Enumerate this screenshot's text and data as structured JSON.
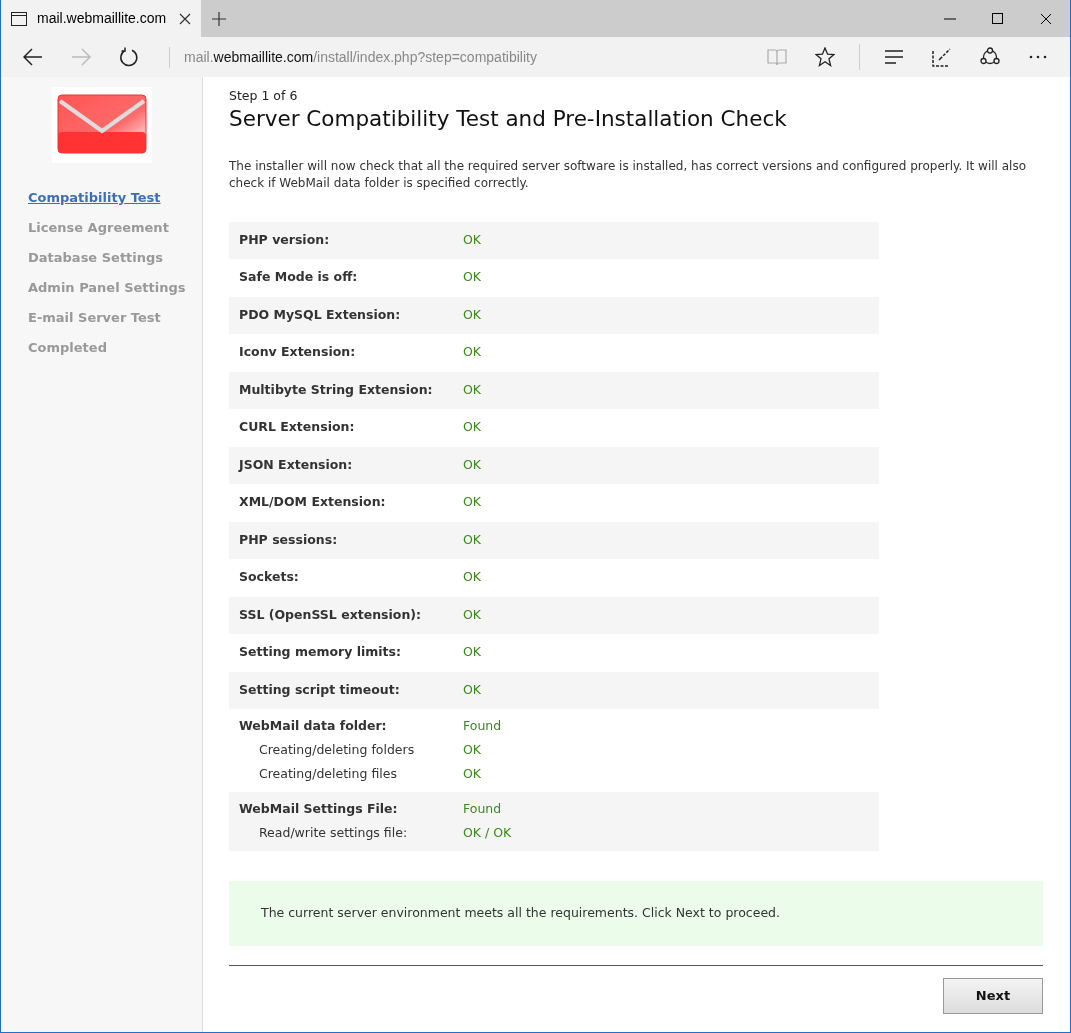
{
  "browser": {
    "tab_title": "mail.webmaillite.com",
    "url": "mail.**webmaillite.com**/install/index.php?step=compatibility",
    "forward_disabled": true,
    "reading_view_disabled": true
  },
  "sidebar": {
    "steps": [
      {
        "label": "Compatibility Test",
        "selected": true
      },
      {
        "label": "License Agreement",
        "selected": false
      },
      {
        "label": "Database Settings",
        "selected": false
      },
      {
        "label": "Admin Panel Settings",
        "selected": false
      },
      {
        "label": "E-mail Server Test",
        "selected": false
      },
      {
        "label": "Completed",
        "selected": false
      }
    ]
  },
  "step_indicator": "Step 1 of 6",
  "title": "Server Compatibility Test and Pre-Installation Check",
  "intro": "The installer will now check that all the required server software is installed, has correct versions and configured properly. It will also check if WebMail data folder is specified correctly.",
  "checks": [
    {
      "label": "PHP version:",
      "value": "OK"
    },
    {
      "label": "Safe Mode is off:",
      "value": "OK"
    },
    {
      "label": "PDO MySQL Extension:",
      "value": "OK"
    },
    {
      "label": "Iconv Extension:",
      "value": "OK"
    },
    {
      "label": "Multibyte String Extension:",
      "value": "OK"
    },
    {
      "label": "CURL Extension:",
      "value": "OK"
    },
    {
      "label": "JSON Extension:",
      "value": "OK"
    },
    {
      "label": "XML/DOM Extension:",
      "value": "OK"
    },
    {
      "label": "PHP sessions:",
      "value": "OK"
    },
    {
      "label": "Sockets:",
      "value": "OK"
    },
    {
      "label": "SSL (OpenSSL extension):",
      "value": "OK"
    },
    {
      "label": "Setting memory limits:",
      "value": "OK"
    },
    {
      "label": "Setting script timeout:",
      "value": "OK"
    },
    {
      "label": "WebMail data folder:",
      "value": "Found",
      "children": [
        {
          "label": "Creating/deleting folders",
          "value": "OK"
        },
        {
          "label": "Creating/deleting files",
          "value": "OK"
        }
      ]
    },
    {
      "label": "WebMail Settings File:",
      "value": "Found",
      "children": [
        {
          "label": "Read/write settings file:",
          "value": "OK / OK"
        }
      ]
    }
  ],
  "result_message": "The current server environment meets all the requirements. Click Next to proceed.",
  "next_button": "Next"
}
